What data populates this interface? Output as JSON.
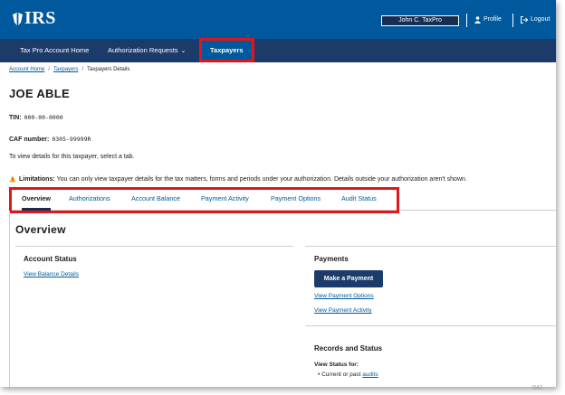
{
  "header": {
    "logo_text": "IRS",
    "user_name": "John C. TaxPro",
    "profile_label": "Profile",
    "logout_label": "Logout"
  },
  "nav": {
    "items": [
      {
        "label": "Tax Pro Account Home"
      },
      {
        "label": "Authorization Requests"
      },
      {
        "label": "Taxpayers"
      }
    ]
  },
  "breadcrumb": {
    "items": [
      "Account Home",
      "Taxpayers",
      "Taxpayers Details"
    ]
  },
  "taxpayer": {
    "name": "JOE ABLE",
    "tin_label": "TIN:",
    "tin_value": "000-00-0000",
    "caf_label": "CAF number:",
    "caf_value": "0305-99999R",
    "instruction": "To view details for this taxpayer, select a tab."
  },
  "limitations": {
    "label": "Limitations:",
    "text": "You can only view taxpayer details for the tax matters, forms and periods under your authorization. Details outside your authorization aren't shown."
  },
  "tabs": [
    {
      "label": "Overview"
    },
    {
      "label": "Authorizations"
    },
    {
      "label": "Account Balance"
    },
    {
      "label": "Payment Activity"
    },
    {
      "label": "Payment Options"
    },
    {
      "label": "Audit Status"
    }
  ],
  "overview": {
    "title": "Overview",
    "account_status": {
      "title": "Account Status",
      "link": "View Balance Details"
    },
    "payments": {
      "title": "Payments",
      "button": "Make a Payment",
      "links": [
        "View Payment Options",
        "View Payment Activity"
      ]
    },
    "records": {
      "title": "Records and Status",
      "view_status_label": "View Status for:",
      "bullet_prefix": "Current or past",
      "bullet_link": "audits"
    }
  },
  "page_number": "041",
  "colors": {
    "header_blue": "#00599c",
    "nav_navy": "#1b3b6b",
    "highlight_red": "#e4141b",
    "link_blue": "#00599c",
    "warning_yellow": "#ffbe2e"
  }
}
